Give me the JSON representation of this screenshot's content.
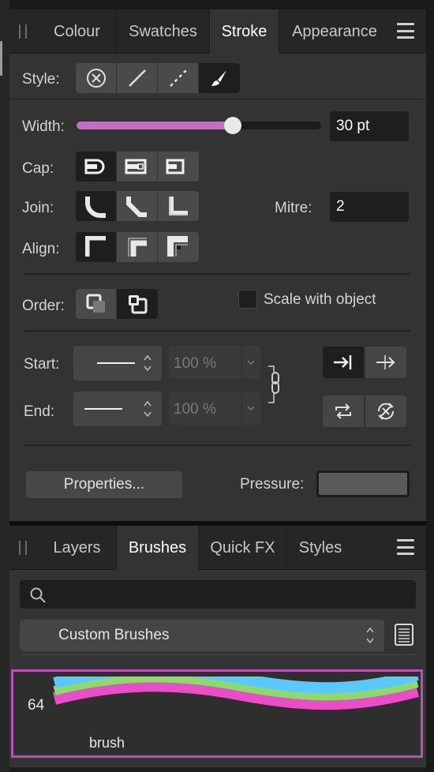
{
  "top_panel": {
    "tabs": [
      {
        "label": "Colour"
      },
      {
        "label": "Swatches"
      },
      {
        "label": "Stroke"
      },
      {
        "label": "Appearance"
      }
    ],
    "active_tab": "Stroke"
  },
  "stroke": {
    "style_label": "Style:",
    "style_options": [
      "none-icon",
      "solid-line-icon",
      "dashed-line-icon",
      "brush-icon"
    ],
    "style_selected": "brush-icon",
    "width_label": "Width:",
    "width_value": "30 pt",
    "width_slider_fraction": 0.64,
    "cap_label": "Cap:",
    "cap_options": [
      "round-cap-icon",
      "square-cap-icon",
      "butt-cap-icon"
    ],
    "join_label": "Join:",
    "join_options": [
      "round-join-icon",
      "bevel-join-icon",
      "mitre-join-icon"
    ],
    "mitre_label": "Mitre:",
    "mitre_value": "2",
    "align_label": "Align:",
    "align_options": [
      "center-align-icon",
      "inside-align-icon",
      "outside-align-icon"
    ],
    "order_label": "Order:",
    "order_options": [
      "stroke-behind-icon",
      "stroke-front-icon"
    ],
    "scale_label": "Scale with object",
    "scale_checked": false,
    "start_label": "Start:",
    "start_percent": "100 %",
    "end_label": "End:",
    "end_percent": "100 %",
    "properties_label": "Properties...",
    "pressure_label": "Pressure:"
  },
  "bottom_panel": {
    "tabs": [
      {
        "label": "Layers"
      },
      {
        "label": "Brushes"
      },
      {
        "label": "Quick FX"
      },
      {
        "label": "Styles"
      }
    ],
    "active_tab": "Brushes",
    "search_placeholder": "",
    "category": "Custom Brushes",
    "brushes": [
      {
        "size": "64",
        "name": "brush"
      }
    ]
  },
  "colors": {
    "accent": "#c36dc4",
    "selection_border": "#b653b4",
    "brush_blue": "#5ac8fa",
    "brush_green": "#8fd86f",
    "brush_pink": "#e84fc6"
  }
}
